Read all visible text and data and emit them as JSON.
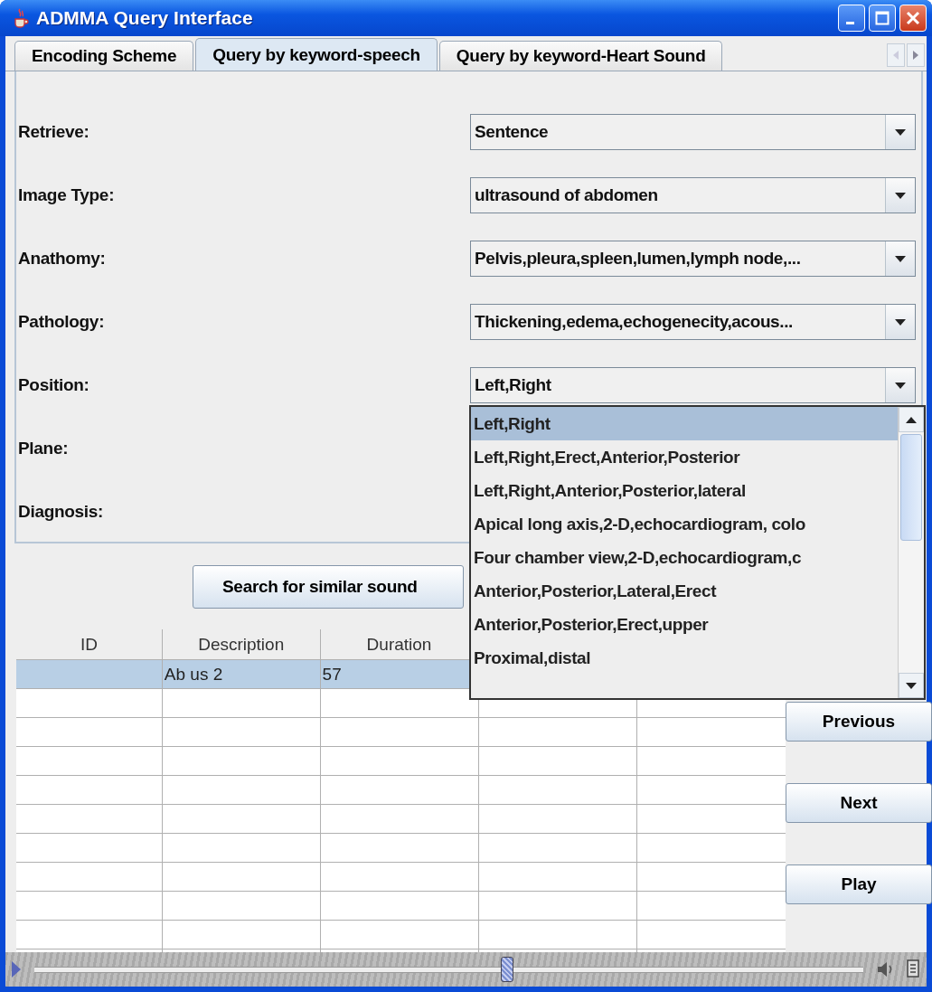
{
  "window": {
    "title": "ADMMA Query Interface"
  },
  "tabs": [
    {
      "label": "Encoding Scheme",
      "selected": false
    },
    {
      "label": "Query by keyword-speech",
      "selected": true
    },
    {
      "label": "Query by keyword-Heart Sound",
      "selected": false
    }
  ],
  "form": [
    {
      "label": "Retrieve:",
      "value": "Sentence"
    },
    {
      "label": "Image Type:",
      "value": "ultrasound of abdomen"
    },
    {
      "label": "Anathomy:",
      "value": "Pelvis,pleura,spleen,lumen,lymph node,..."
    },
    {
      "label": "Pathology:",
      "value": "Thickening,edema,echogenecity,acous..."
    },
    {
      "label": "Position:",
      "value": "Left,Right"
    },
    {
      "label": "Plane:"
    },
    {
      "label": "Diagnosis:"
    }
  ],
  "dropdown_list": [
    {
      "label": "Left,Right",
      "selected": true
    },
    {
      "label": "Left,Right,Erect,Anterior,Posterior",
      "selected": false
    },
    {
      "label": "Left,Right,Anterior,Posterior,lateral",
      "selected": false
    },
    {
      "label": "Apical long axis,2-D,echocardiogram, colo",
      "selected": false
    },
    {
      "label": "Four chamber view,2-D,echocardiogram,c",
      "selected": false
    },
    {
      "label": "Anterior,Posterior,Lateral,Erect",
      "selected": false
    },
    {
      "label": "Anterior,Posterior,Erect,upper",
      "selected": false
    },
    {
      "label": "Proximal,distal",
      "selected": false
    }
  ],
  "search_button": "Search for similar sound",
  "table": {
    "columns": [
      "ID",
      "Description",
      "Duration"
    ],
    "rows": [
      {
        "selected": true,
        "cells": [
          null,
          "Ab us 2",
          "57"
        ]
      }
    ]
  },
  "side_buttons": [
    "Previous",
    "Next",
    "Play"
  ],
  "player": {
    "level": 0.57
  }
}
